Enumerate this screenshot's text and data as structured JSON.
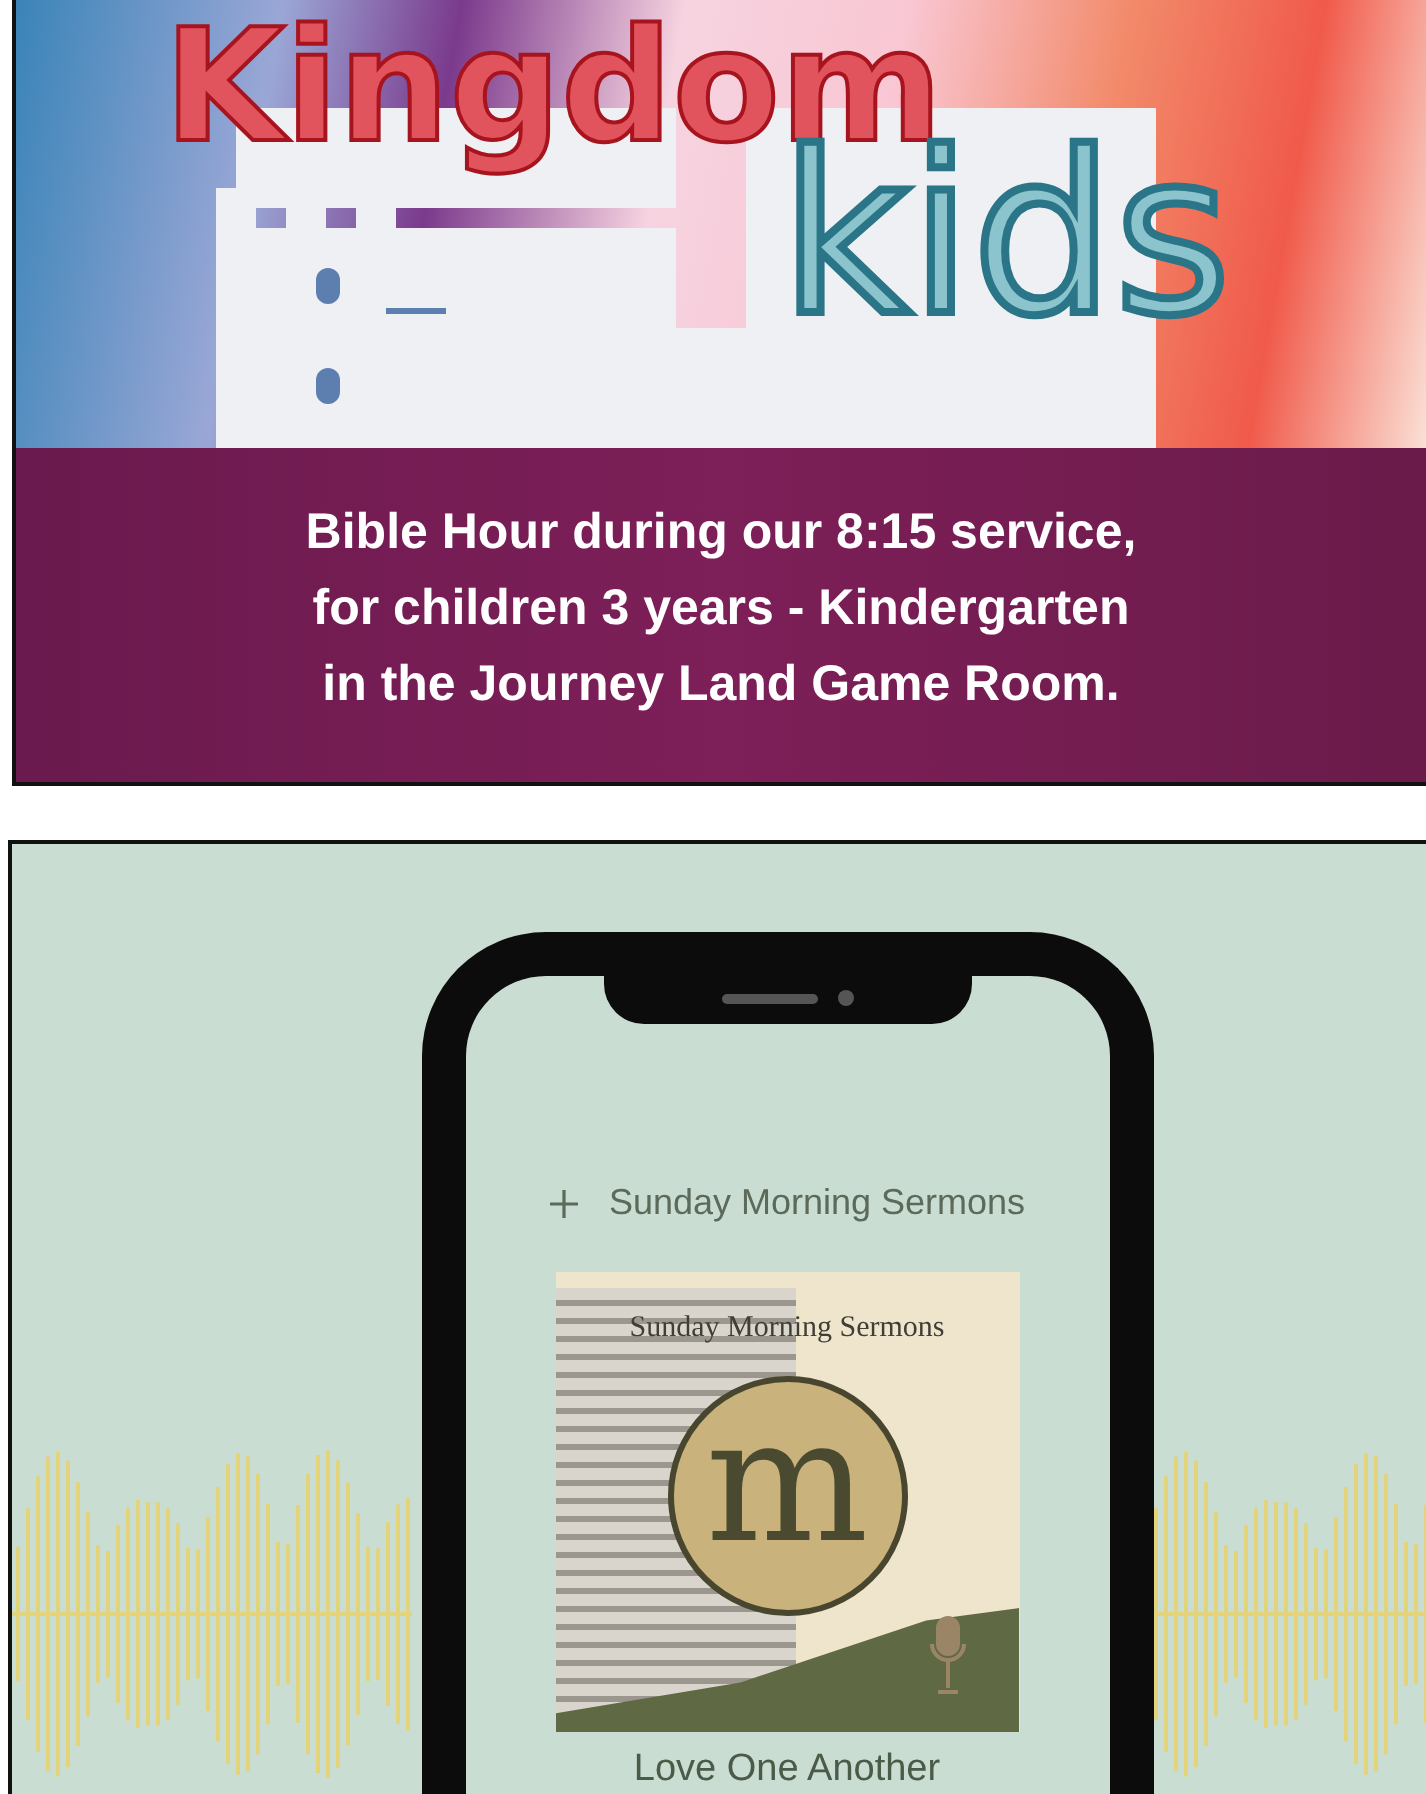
{
  "banner": {
    "title": "Kingdom",
    "subtitle": "kids",
    "lines": [
      "Bible Hour during our 8:15 service,",
      "for children 3 years - Kindergarten",
      "in the Journey Land Game Room."
    ]
  },
  "podcast": {
    "show_title": "Sunday Morning Sermons",
    "cover_title": "Sunday Morning Sermons",
    "cover_letter": "m",
    "episode": "Love One Another"
  }
}
